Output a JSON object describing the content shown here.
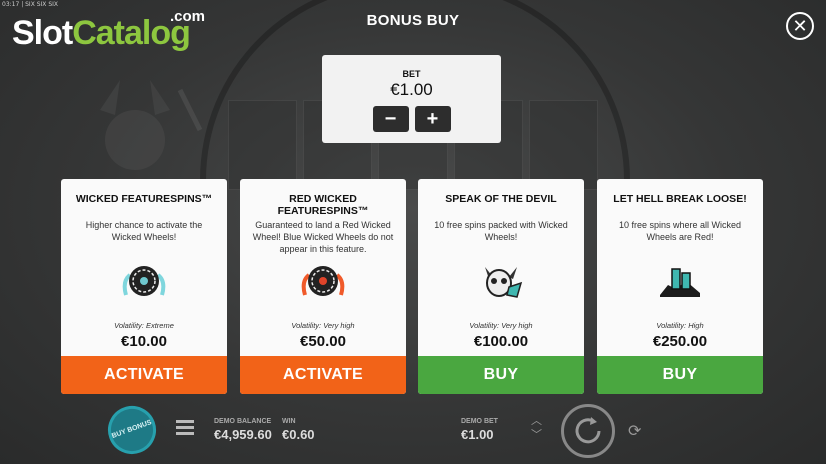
{
  "status_bar": {
    "text": "03:17 | SIX SIX SIX"
  },
  "logo": {
    "part1": "Slot",
    "part2": "Catalog",
    "suffix": ".com"
  },
  "dialog": {
    "title": "BONUS BUY",
    "close_icon": "close-icon"
  },
  "bet": {
    "label": "BET",
    "value": "€1.00",
    "minus": "−",
    "plus": "+"
  },
  "cards": [
    {
      "title": "WICKED FEATURESPINS™",
      "description": "Higher chance to activate the Wicked Wheels!",
      "icon": "wicked-wheel-icon",
      "volatility": "Volatility: Extreme",
      "price": "€10.00",
      "action": "ACTIVATE",
      "action_color": "#f26318"
    },
    {
      "title": "RED WICKED FEATURESPINS™",
      "description": "Guaranteed to land a Red Wicked Wheel! Blue Wicked Wheels do not appear in this feature.",
      "icon": "red-wheel-icon",
      "volatility": "Volatility: Very high",
      "price": "€50.00",
      "action": "ACTIVATE",
      "action_color": "#f26318"
    },
    {
      "title": "SPEAK OF THE DEVIL",
      "description": "10 free spins packed with Wicked Wheels!",
      "icon": "devil-skull-icon",
      "volatility": "Volatility: Very high",
      "price": "€100.00",
      "action": "BUY",
      "action_color": "#4aa740"
    },
    {
      "title": "LET HELL BREAK LOOSE!",
      "description": "10 free spins where all Wicked Wheels are Red!",
      "icon": "hell-logo-icon",
      "volatility": "Volatility: High",
      "price": "€250.00",
      "action": "BUY",
      "action_color": "#4aa740"
    }
  ],
  "bottom_bar": {
    "buy_bonus": "BUY BONUS",
    "demo_balance_label": "DEMO BALANCE",
    "demo_balance_value": "€4,959.60",
    "win_label": "WIN",
    "win_value": "€0.60",
    "demo_bet_label": "DEMO BET",
    "demo_bet_value": "€1.00"
  }
}
